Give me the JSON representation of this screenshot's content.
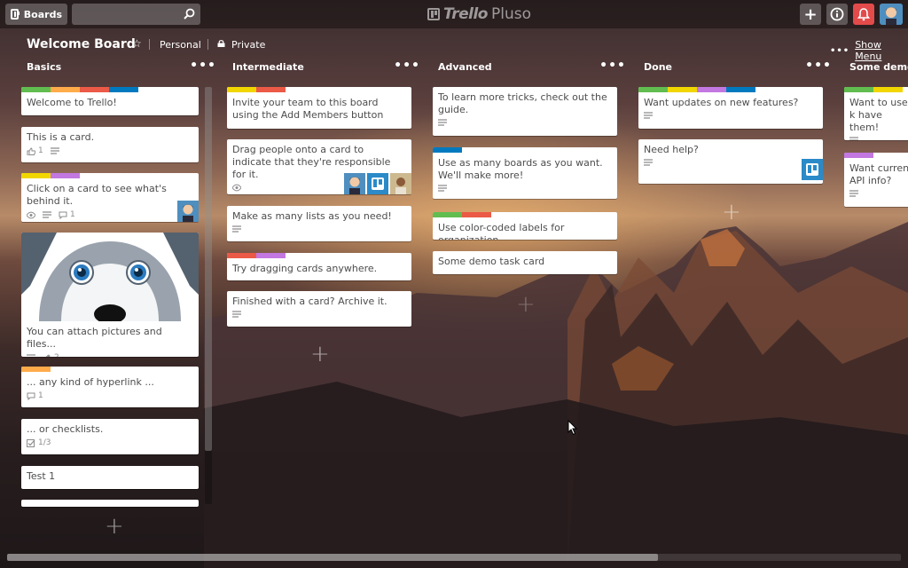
{
  "header": {
    "boards_label": "Boards",
    "search_value": "",
    "logo_trello": "Trello",
    "logo_suffix": "Pluso",
    "add_label": "+",
    "info_label": "i"
  },
  "board": {
    "title": "Welcome Board",
    "team": "Personal",
    "visibility": "Private",
    "menu_label": "Show Menu"
  },
  "colors": {
    "green": "#61bd4f",
    "yellow": "#f2d600",
    "orange": "#ffab4a",
    "red": "#eb5a46",
    "purple": "#c377e0",
    "blue": "#0079bf",
    "notification": "#e34b4b"
  },
  "lists": [
    {
      "title": "Basics",
      "cards": [
        {
          "text": "Welcome to Trello!",
          "labels": [
            "green",
            "orange",
            "red",
            "blue"
          ]
        },
        {
          "text": "This is a card.",
          "badges": [
            {
              "icon": "thumb-up-icon",
              "value": "1"
            },
            {
              "icon": "description-icon",
              "value": ""
            }
          ]
        },
        {
          "text": "Click on a card to see what's behind it.",
          "labels": [
            "yellow",
            "purple"
          ],
          "badges": [
            {
              "icon": "eye-icon",
              "value": ""
            },
            {
              "icon": "description-icon",
              "value": ""
            },
            {
              "icon": "comment-icon",
              "value": "1"
            }
          ]
        },
        {
          "text": "You can attach pictures and files...",
          "cover": "husky-illustration",
          "badges": [
            {
              "icon": "description-icon",
              "value": ""
            },
            {
              "icon": "attachment-icon",
              "value": "2"
            }
          ]
        },
        {
          "text": "... any kind of hyperlink ...",
          "labels": [
            "orange"
          ],
          "badges": [
            {
              "icon": "comment-icon",
              "value": "1"
            }
          ]
        },
        {
          "text": "... or checklists.",
          "badges": [
            {
              "icon": "checklist-icon",
              "value": "1/3"
            }
          ]
        },
        {
          "text": "Test 1"
        }
      ]
    },
    {
      "title": "Intermediate",
      "cards": [
        {
          "text": "Invite your team to this board using the Add Members button",
          "labels": [
            "yellow",
            "red"
          ]
        },
        {
          "text": "Drag people onto a card to indicate that they're responsible for it.",
          "badges": [
            {
              "icon": "eye-icon",
              "value": ""
            }
          ]
        },
        {
          "text": "Make as many lists as you need!",
          "badges": [
            {
              "icon": "description-icon",
              "value": ""
            }
          ]
        },
        {
          "text": "Try dragging cards anywhere.",
          "labels": [
            "red",
            "purple"
          ]
        },
        {
          "text": "Finished with a card? Archive it.",
          "badges": [
            {
              "icon": "description-icon",
              "value": ""
            }
          ]
        }
      ]
    },
    {
      "title": "Advanced",
      "cards": [
        {
          "text": "To learn more tricks, check out the guide.",
          "badges": [
            {
              "icon": "description-icon",
              "value": ""
            }
          ]
        },
        {
          "text": "Use as many boards as you want. We'll make more!",
          "labels": [
            "blue"
          ],
          "badges": [
            {
              "icon": "description-icon",
              "value": ""
            }
          ]
        },
        {
          "text": "Use color-coded labels for organization",
          "labels": [
            "green",
            "red"
          ]
        },
        {
          "text": "Some demo task card"
        }
      ]
    },
    {
      "title": "Done",
      "cards": [
        {
          "text": "Want updates on new features?",
          "labels": [
            "green",
            "yellow",
            "purple",
            "blue"
          ],
          "badges": [
            {
              "icon": "description-icon",
              "value": ""
            }
          ]
        },
        {
          "text": "Need help?",
          "badges": [
            {
              "icon": "description-icon",
              "value": ""
            }
          ]
        }
      ]
    },
    {
      "title": "Some demo l",
      "cards": [
        {
          "text": "Want to use k have them!",
          "labels": [
            "green",
            "yellow"
          ],
          "badges": [
            {
              "icon": "description-icon",
              "value": ""
            }
          ]
        },
        {
          "text": "Want current API info?",
          "labels": [
            "purple"
          ],
          "badges": [
            {
              "icon": "description-icon",
              "value": ""
            }
          ]
        }
      ]
    }
  ],
  "add_card_symbol": "+"
}
